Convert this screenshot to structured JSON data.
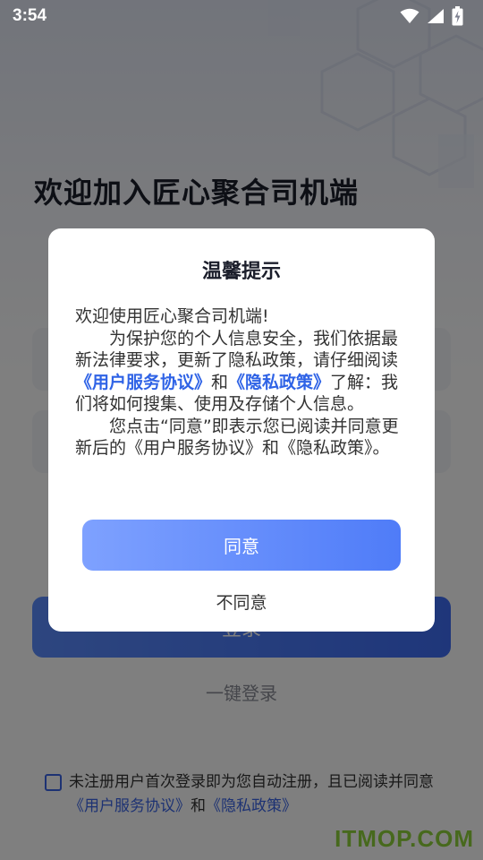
{
  "status_bar": {
    "time": "3:54",
    "icons": [
      "wifi-icon",
      "signal-icon",
      "battery-charging-icon"
    ]
  },
  "login": {
    "welcome_title": "欢迎加入匠心聚合司机端",
    "login_button": "登录",
    "one_click_login": "一键登录",
    "agreement": {
      "prefix": "未注册用户首次登录即为您自动注册，且已阅读并同意",
      "link_service": "《用户服务协议》",
      "conjunction": "和",
      "link_privacy": "《隐私政策》"
    }
  },
  "dialog": {
    "title": "温馨提示",
    "greeting": "欢迎使用匠心聚合司机端!",
    "para1_a": "为保护您的个人信息安全，我们依据最新法律要求，更新了隐私政策，请仔细阅读",
    "para1_link_service": "《用户服务协议》",
    "para1_and": "和",
    "para1_link_privacy": "《隐私政策》",
    "para1_b": "了解：我们将如何搜集、使用及存储个人信息。",
    "para2": "您点击“同意”即表示您已阅读并同意更新后的《用户服务协议》和《隐私政策》。",
    "agree_button": "同意",
    "disagree_button": "不同意"
  },
  "watermark": "ITMOP.COM",
  "colors": {
    "accent": "#3a64e6",
    "agree_gradient_start": "#7ea1ff",
    "agree_gradient_end": "#4f7cf8",
    "watermark": "#8fd23a"
  }
}
